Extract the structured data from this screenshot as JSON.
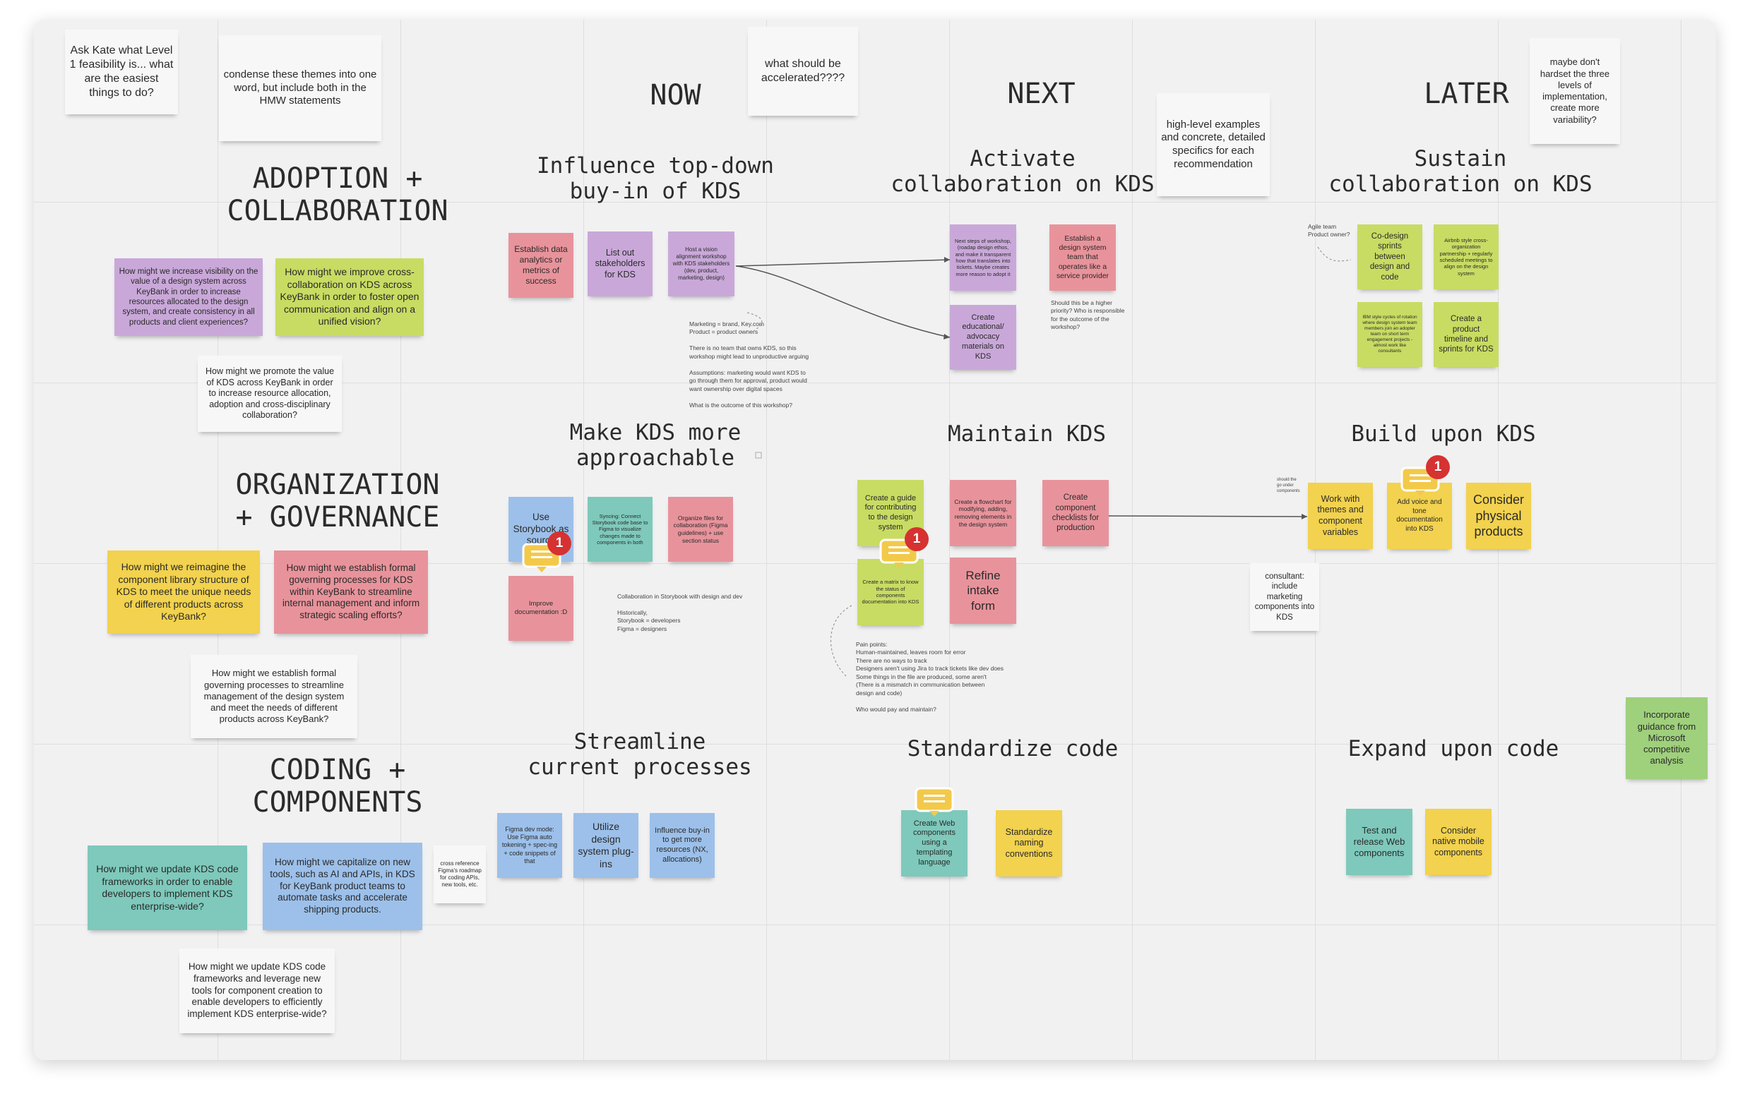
{
  "phases": {
    "now": "NOW",
    "next": "NEXT",
    "later": "LATER"
  },
  "themes": {
    "adoption": "ADOPTION +\nCOLLABORATION",
    "org": "ORGANIZATION\n+ GOVERNANCE",
    "coding": "CODING +\nCOMPONENTS"
  },
  "subheaders": {
    "influence": "Influence top-down\nbuy-in of KDS",
    "activate": "Activate\ncollaboration on KDS",
    "sustain": "Sustain\ncollaboration on KDS",
    "approachable": "Make KDS more\napproachable",
    "maintain": "Maintain KDS",
    "build": "Build upon KDS",
    "streamline": "Streamline\ncurrent processes",
    "standardize": "Standardize code",
    "expand": "Expand upon code"
  },
  "comments": {
    "ask_kate": "Ask Kate what Level 1 feasibility is... what are the easiest things to do?",
    "condense": "condense these themes into one word, but include both in the HMW statements",
    "accelerated": "what should be accelerated????",
    "high_level": "high-level examples and concrete, detailed specifics for each recommendation",
    "dont_hardset": "maybe don't hardset the three levels of implementation, create more variability?"
  },
  "hmw": {
    "visibility": "How might we increase visibility on the value of a design system across KeyBank in order to increase resources allocated to the design system, and create consistency in all products and client experiences?",
    "cross_collab": "How might we improve cross-collaboration on KDS across KeyBank in order to foster open communication and align on a unified vision?",
    "promote": "How might we promote the value of KDS across KeyBank in order to increase resource allocation, adoption and cross-disciplinary collaboration?",
    "reimagine": "How might we reimagine the component library structure of KDS to meet the unique needs of different products across KeyBank?",
    "formal": "How might we establish formal governing processes for KDS within KeyBank to streamline internal management and inform strategic scaling efforts?",
    "formal2": "How might we establish formal governing processes to streamline management of the design system and meet the needs of different products across KeyBank?",
    "update": "How might we update KDS code frameworks in order to enable developers to implement KDS enterprise-wide?",
    "capitalize": "How might we capitalize on new tools, such as AI and APIs, in KDS for KeyBank product teams to automate tasks and accelerate shipping products.",
    "update2": "How might we update KDS code frameworks and leverage new tools for component creation to enable developers to efficiently implement KDS enterprise-wide?"
  },
  "stickies": {
    "analytics": "Establish data analytics or metrics of success",
    "list_out": "List out stakeholders for KDS",
    "vision": "Host a vision alignment workshop with KDS stakeholders (dev, product, marketing, design)",
    "next_steps": "Next steps of workshop, (roadap design ethos, and make it transparent how that translates into tickets. Maybe creates more reason to adopt it",
    "establish_team": "Establish a design system team that operates like a service provider",
    "educational": "Create educational/ advocacy materials on KDS",
    "codesign": "Co-design sprints between design and code",
    "airbnb": "Airbnb style cross-organization partnership + regularly scheduled meetings to align on the design system",
    "ibm": "IBM style cycles of rotation where design system team members join an adopter team on short term engagement projects - almost work like consultants",
    "timeline": "Create a product timeline and sprints for KDS",
    "storybook": "Use Storybook as source",
    "syncing": "Syncing: Connect Storybook code base to Figma to visualize changes made to components in both",
    "organize": "Organize files for collaboration (Figma guidelines) + use section status",
    "improve_doc": "Improve documentation :D",
    "guide": "Create a guide for contributing to the design system",
    "flowchart": "Create a flowchart for modifying, adding, removing elements in the design system",
    "checklists": "Create component checklists for production",
    "matrix": "Create a matrix to know the status of components documentation into KDS",
    "refine": "Refine intake form",
    "themes_vars": "Work with themes and component variables",
    "voice_tone": "Add voice and tone documentation into KDS",
    "physical": "Consider physical products",
    "figma_dev": "Figma dev mode: Use Figma auto tokening + spec-ing + code snippets of that",
    "plugins": "Utilize design system plug-ins",
    "influence_buy": "Influence buy-in to get more resources (NX, allocations)",
    "web_components": "Create Web components using a templating language",
    "naming": "Standardize naming conventions",
    "test_release": "Test and release Web components",
    "native": "Consider native mobile components",
    "microsoft": "Incorporate guidance from Microsoft competitive analysis",
    "consultant": "consultant: include marketing components into KDS",
    "cross_ref": "cross reference Figma's roadmap for coding APIs, new tools, etc."
  },
  "texts": {
    "marketing": "Marketing = brand, Key.com\nProduct = product owners\n\nThere is no team that owns KDS, so this\nworkshop might lead to unproductive arguing\n\nAssumptions: marketing would want KDS to\ngo through them for approval, product would\nwant ownership over digital spaces\n\nWhat is the outcome of this workshop?",
    "priority": "Should this be a higher\npriority? Who is responsible\nfor the outcome of the\nworkshop?",
    "agile": "Agile team\nProduct owner?",
    "collab_storybook": "Collaboration in Storybook with design and dev\n\nHistorically,\nStorybook = developers\nFigma = designers",
    "pain_points": "Pain points:\nHuman-maintained, leaves room for error\nThere are no ways to track\nDesigners aren't using Jira to track tickets like dev does\nSome things in the file are produced, some aren't\n(There is a mismatch in communication between\ndesign and code)\n\nWho would pay and maintain?",
    "should_be": "should the\ngo under\ncomponents"
  },
  "badges": {
    "storybook": "1",
    "matrix": "1",
    "voice": "1"
  },
  "colors": {
    "purple": "#c9a8d9",
    "lime": "#c8dc63",
    "yellow": "#f2d24e",
    "red": "#e8939b",
    "teal": "#7ec9bb",
    "blue": "#9cc0ea",
    "green": "#9fd07c",
    "comment": "#f3c94a",
    "badge": "#d63232"
  }
}
